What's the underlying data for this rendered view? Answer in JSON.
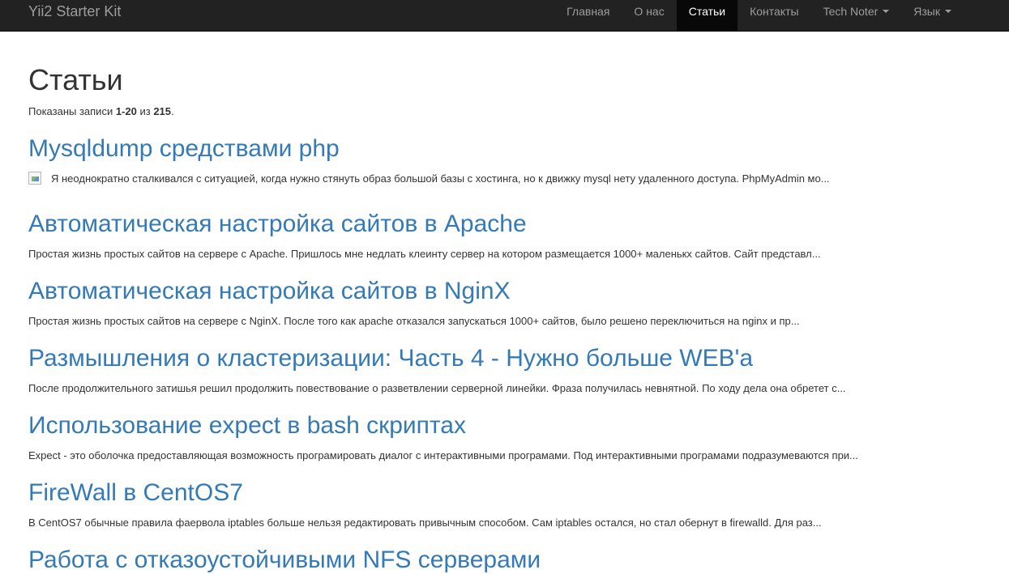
{
  "navbar": {
    "brand": "Yii2 Starter Kit",
    "items": [
      {
        "label": "Главная",
        "active": false,
        "dropdown": false
      },
      {
        "label": "О нас",
        "active": false,
        "dropdown": false
      },
      {
        "label": "Статьи",
        "active": true,
        "dropdown": false
      },
      {
        "label": "Контакты",
        "active": false,
        "dropdown": false
      },
      {
        "label": "Tech Noter",
        "active": false,
        "dropdown": true
      },
      {
        "label": "Язык",
        "active": false,
        "dropdown": true
      }
    ]
  },
  "page": {
    "title": "Статьи",
    "summary_prefix": "Показаны записи ",
    "summary_range": "1-20",
    "summary_mid": " из ",
    "summary_total": "215",
    "summary_suffix": "."
  },
  "articles": [
    {
      "title": "Mysqldump средствами php",
      "excerpt": "Я неоднократно сталкивался с ситуацией, когда нужно стянуть образ большой базы с хостинга, но к движку mysql нету удаленного доступа. PhpMyAdmin мо...",
      "has_thumbnail": true
    },
    {
      "title": "Автоматическая настройка сайтов в Apache",
      "excerpt": "Простая жизнь простых сайтов на сервере с Apache. Пришлось мне недлать клеинту сервер на котором размещается 1000+ маленькх сайтов. Сайт представл..."
    },
    {
      "title": "Автоматическая настройка сайтов в NginX",
      "excerpt": "Простая жизнь простых сайтов на сервере с NginX. После того как apache отказался запускаться 1000+ сайтов, было решено переключиться на nginx и пр..."
    },
    {
      "title": "Размышления о кластеризации: Часть 4 - Нужно больше WEB'a",
      "excerpt": "После продолжительного затишья решил продолжить повествование о разветвлении серверной линейки. Фраза получилась невнятной. По ходу дела она обретет с..."
    },
    {
      "title": "Использование expect в bash скриптах",
      "excerpt": "Expect - это оболочка предоставляющая возможность програмировать диалог с интерактивными програмами. Под интерактивными програмами подразумеваются при..."
    },
    {
      "title": "FireWall в CentOS7",
      "excerpt": "В CentOS7 обычные правила фаервола iptables больше нельзя редактировать привычным способом. Сам iptables остался, но стал обернут в firewalld. Для раз..."
    },
    {
      "title": "Работа с отказоустойчивыми NFS серверами",
      "excerpt": ""
    }
  ]
}
